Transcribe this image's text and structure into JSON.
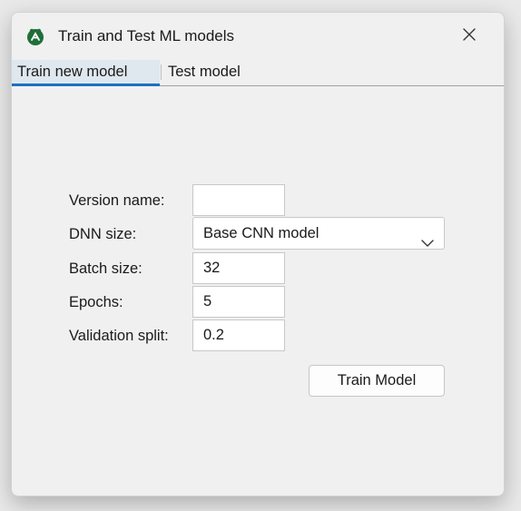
{
  "window": {
    "title": "Train and Test ML models",
    "icon": "green-leaf-app-icon",
    "close_icon": "close-icon"
  },
  "tabs": [
    {
      "label": "Train new model",
      "active": true
    },
    {
      "label": "Test model",
      "active": false
    }
  ],
  "form": {
    "version_name": {
      "label": "Version name:",
      "value": ""
    },
    "dnn_size": {
      "label": "DNN size:",
      "selected": "Base CNN model"
    },
    "batch_size": {
      "label": "Batch size:",
      "value": "32"
    },
    "epochs": {
      "label": "Epochs:",
      "value": "5"
    },
    "validation_split": {
      "label": "Validation split:",
      "value": "0.2"
    }
  },
  "actions": {
    "train_label": "Train Model"
  },
  "colors": {
    "window_bg": "#f0f0f0",
    "active_tab_underline": "#1e6fbf",
    "icon_green": "#1f6e3a"
  }
}
